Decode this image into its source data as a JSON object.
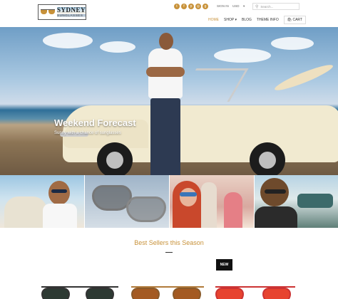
{
  "brand": {
    "name": "SYDNEY",
    "tagline": "SUNGLASSES"
  },
  "social": [
    {
      "icon": "twitter-icon",
      "glyph": "t"
    },
    {
      "icon": "facebook-icon",
      "glyph": "f"
    },
    {
      "icon": "pinterest-icon",
      "glyph": "p"
    },
    {
      "icon": "instagram-icon",
      "glyph": "◎"
    },
    {
      "icon": "google-plus-icon",
      "glyph": "g"
    }
  ],
  "account": {
    "sign_in": "SIGN IN",
    "currency": "USD",
    "caret": "▾"
  },
  "search": {
    "placeholder": "Search...",
    "icon": "search-icon"
  },
  "nav": {
    "home": "HOME",
    "shop": "SHOP ▾",
    "blog": "BLOG",
    "theme_info": "THEME INFO",
    "cart": "CART"
  },
  "hero": {
    "headline": "Weekend Forecast",
    "subline": "Sunny with a chance of sunglasses"
  },
  "slider": {
    "dots": 2,
    "active": 1
  },
  "section": {
    "title": "Best Sellers this Season",
    "badge": "NEW"
  },
  "colors": {
    "accent": "#c8923a",
    "dark": "#111111"
  }
}
